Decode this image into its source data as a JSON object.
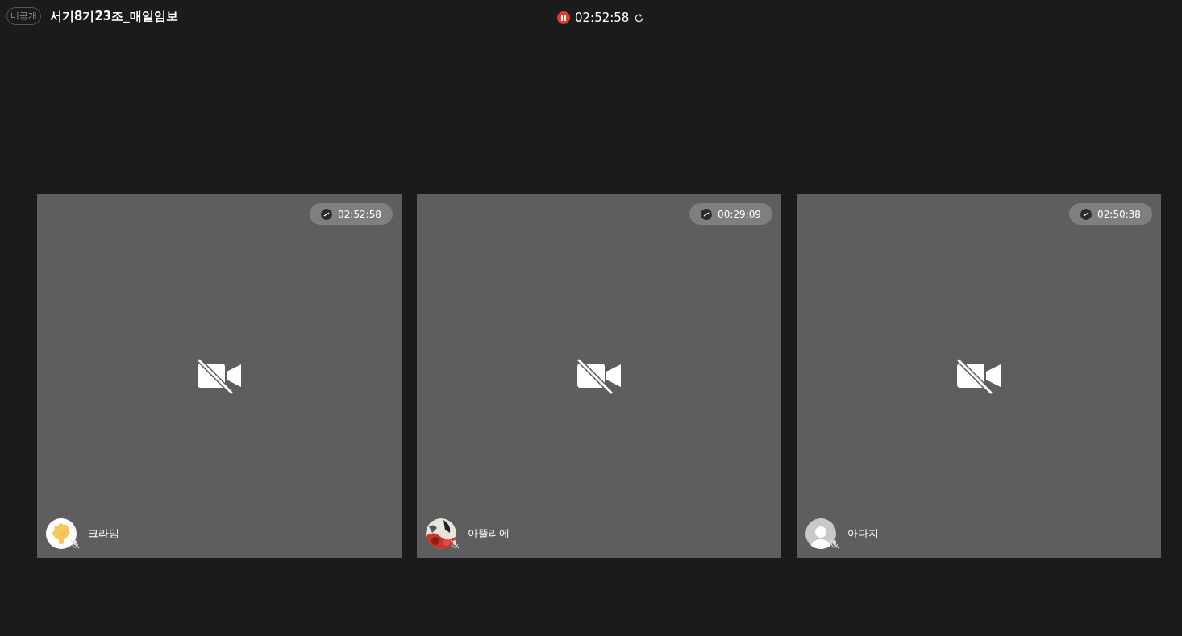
{
  "header": {
    "visibility_badge": "비공개",
    "room_title": "서기8기23조_매일임보",
    "recording": {
      "paused": true,
      "time": "02:52:58"
    }
  },
  "participants": [
    {
      "name": "크라임",
      "time": "02:52:58",
      "avatar": {
        "kind": "character"
      },
      "camera_off": true,
      "mic_muted": true
    },
    {
      "name": "아뜰리에",
      "time": "00:29:09",
      "camera_off": true,
      "mic_muted": true
    },
    {
      "name": "아다지",
      "time": "02:50:38",
      "avatar": {
        "kind": "default"
      },
      "camera_off": true,
      "mic_muted": true
    }
  ]
}
